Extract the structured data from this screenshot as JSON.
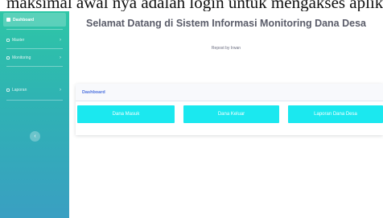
{
  "top_strip": {
    "text": "maksimal awal nya adalah login untuk mengakses aplikasi"
  },
  "sidebar": {
    "brand": "Dashboard",
    "items": [
      {
        "label": "Master",
        "icon": "box-icon"
      },
      {
        "label": "Monitoring",
        "icon": "chart-icon"
      },
      {
        "label": "Laporan",
        "icon": "report-icon"
      }
    ],
    "toggle_icon": "chevron-left-icon"
  },
  "header": {
    "title": "Selamat Datang di Sistem Informasi Monitoring Dana Desa",
    "subtitle": "Repost by Irwan"
  },
  "dashboard_card": {
    "title": "Dashboard",
    "tiles": [
      {
        "label": "Dana Masuk"
      },
      {
        "label": "Dana Keluar"
      },
      {
        "label": "Laporan Dana Desa"
      }
    ]
  },
  "colors": {
    "sidebar_top": "#2ec6a6",
    "sidebar_bottom": "#3a9fc2",
    "tile": "#1be8ef",
    "card_title": "#4e73df"
  }
}
